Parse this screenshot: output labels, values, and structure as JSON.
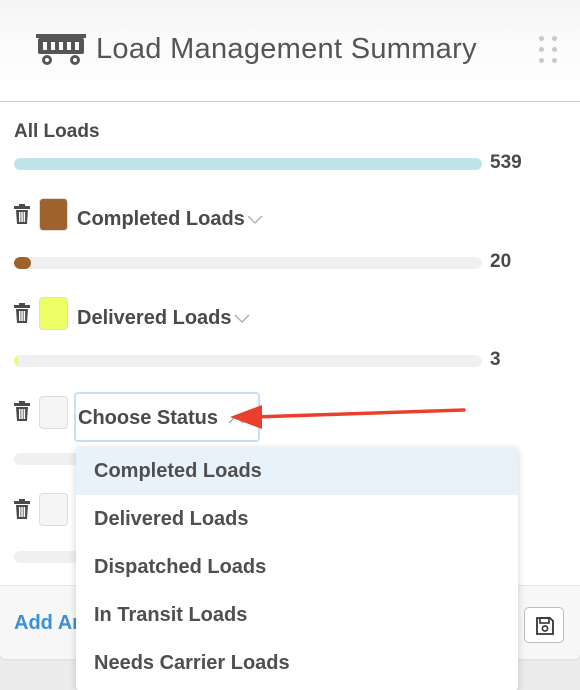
{
  "header": {
    "title": "Load Management Summary",
    "icon": "truck-icon",
    "drag_icon": "drag-handle-icon"
  },
  "all_loads": {
    "label": "All Loads",
    "count": "539",
    "fill_fraction": 1.0,
    "color": "#bfe4ea"
  },
  "rows": [
    {
      "label": "Completed Loads",
      "count": "20",
      "swatch": "#a0622d",
      "fill_fraction": 0.037,
      "fill_color": "#a0622d"
    },
    {
      "label": "Delivered Loads",
      "count": "3",
      "swatch": "#eeff66",
      "fill_fraction": 0.006,
      "fill_color": "#eeff66"
    },
    {
      "label": "Choose Status",
      "count": "",
      "swatch": "#f5f5f5",
      "fill_fraction": 0
    },
    {
      "label": "",
      "count": "",
      "swatch": "#f5f5f5",
      "fill_fraction": 0
    }
  ],
  "dropdown": {
    "options": [
      "Completed Loads",
      "Delivered Loads",
      "Dispatched Loads",
      "In Transit Loads",
      "Needs Carrier Loads"
    ],
    "highlighted_index": 0
  },
  "footer": {
    "add_label": "Add An",
    "save_icon": "save-icon"
  },
  "colors": {
    "annotation_arrow": "#e8402c",
    "link": "#3a8fd6",
    "focus_border": "#c9dff1"
  }
}
